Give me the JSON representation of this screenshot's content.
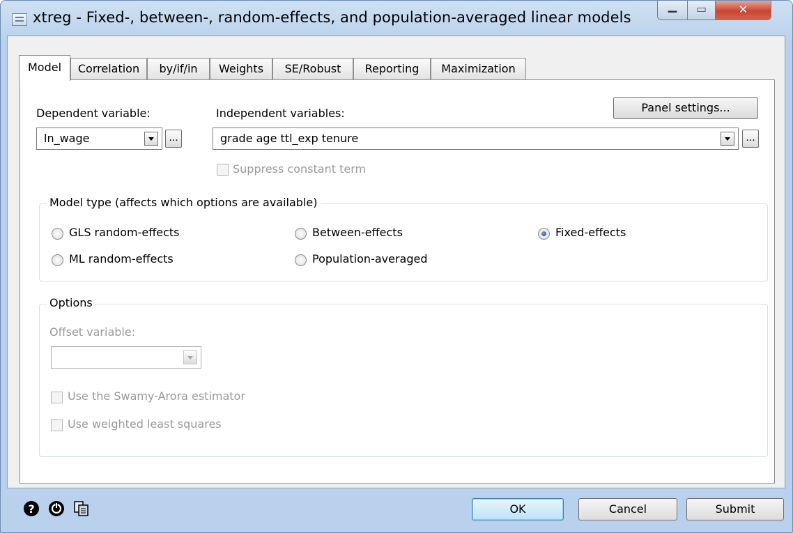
{
  "window": {
    "title": "xtreg - Fixed-, between-, random-effects, and population-averaged linear models",
    "icons": [
      "app-icon",
      "minimize-icon",
      "maximize-icon",
      "close-icon"
    ]
  },
  "tabs": [
    {
      "label": "Model",
      "active": true
    },
    {
      "label": "Correlation"
    },
    {
      "label": "by/if/in"
    },
    {
      "label": "Weights"
    },
    {
      "label": "SE/Robust"
    },
    {
      "label": "Reporting"
    },
    {
      "label": "Maximization"
    }
  ],
  "model": {
    "dep_label": "Dependent variable:",
    "dep_value": "ln_wage",
    "indep_label": "Independent variables:",
    "indep_value": "grade age ttl_exp tenure",
    "panel_button": "Panel settings...",
    "ellipsis": "...",
    "suppress_label": "Suppress constant term",
    "model_type_title": "Model type (affects which options are available)",
    "radios": {
      "gls": "GLS random-effects",
      "ml": "ML random-effects",
      "between": "Between-effects",
      "pa": "Population-averaged",
      "fixed": "Fixed-effects"
    },
    "selected_model": "Fixed-effects",
    "options_title": "Options",
    "offset_label": "Offset variable:",
    "offset_value": "",
    "swamy_label": "Use the Swamy-Arora estimator",
    "wls_label": "Use weighted least squares"
  },
  "footer": {
    "icons": [
      "help-icon",
      "reset-icon",
      "copy-icon"
    ],
    "ok": "OK",
    "cancel": "Cancel",
    "submit": "Submit"
  }
}
